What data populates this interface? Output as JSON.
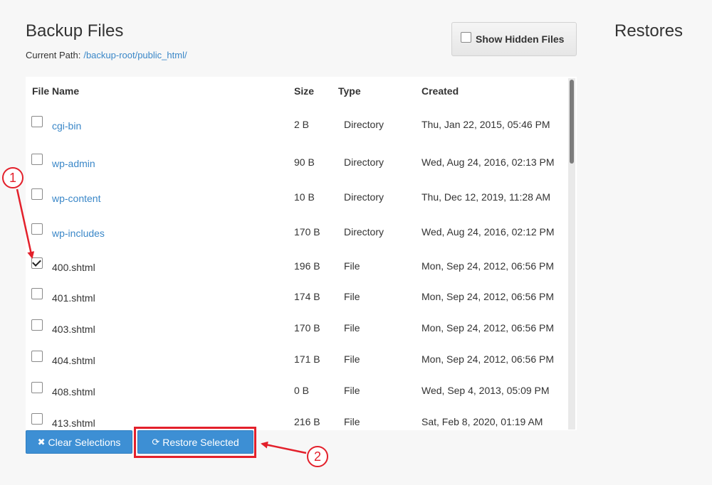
{
  "header": {
    "title": "Backup Files",
    "current_path_label": "Current Path:",
    "current_path_value": "/backup-root/public_html/",
    "show_hidden_label": "Show Hidden Files",
    "restores_title": "Restores"
  },
  "table": {
    "columns": [
      "File Name",
      "Size",
      "Type",
      "Created"
    ],
    "rows": [
      {
        "name": "cgi-bin",
        "size": "2 B",
        "type": "Directory",
        "created": "Thu, Jan 22, 2015, 05:46 PM",
        "is_link": true,
        "checked": false
      },
      {
        "name": "wp-admin",
        "size": "90 B",
        "type": "Directory",
        "created": "Wed, Aug 24, 2016, 02:13 PM",
        "is_link": true,
        "checked": false
      },
      {
        "name": "wp-content",
        "size": "10 B",
        "type": "Directory",
        "created": "Thu, Dec 12, 2019, 11:28 AM",
        "is_link": true,
        "checked": false
      },
      {
        "name": "wp-includes",
        "size": "170 B",
        "type": "Directory",
        "created": "Wed, Aug 24, 2016, 02:12 PM",
        "is_link": true,
        "checked": false
      },
      {
        "name": "400.shtml",
        "size": "196 B",
        "type": "File",
        "created": "Mon, Sep 24, 2012, 06:56 PM",
        "is_link": false,
        "checked": true
      },
      {
        "name": "401.shtml",
        "size": "174 B",
        "type": "File",
        "created": "Mon, Sep 24, 2012, 06:56 PM",
        "is_link": false,
        "checked": false
      },
      {
        "name": "403.shtml",
        "size": "170 B",
        "type": "File",
        "created": "Mon, Sep 24, 2012, 06:56 PM",
        "is_link": false,
        "checked": false
      },
      {
        "name": "404.shtml",
        "size": "171 B",
        "type": "File",
        "created": "Mon, Sep 24, 2012, 06:56 PM",
        "is_link": false,
        "checked": false
      },
      {
        "name": "408.shtml",
        "size": "0 B",
        "type": "File",
        "created": "Wed, Sep 4, 2013, 05:09 PM",
        "is_link": false,
        "checked": false
      },
      {
        "name": "413.shtml",
        "size": "216 B",
        "type": "File",
        "created": "Sat, Feb 8, 2020, 01:19 AM",
        "is_link": false,
        "checked": false
      }
    ]
  },
  "actions": {
    "clear_label": "Clear Selections",
    "restore_label": "Restore Selected"
  },
  "annotations": {
    "callout_1": "1",
    "callout_2": "2"
  },
  "colors": {
    "link": "#3a87c8",
    "button": "#3d8fd4",
    "annotation": "#e3202b"
  }
}
